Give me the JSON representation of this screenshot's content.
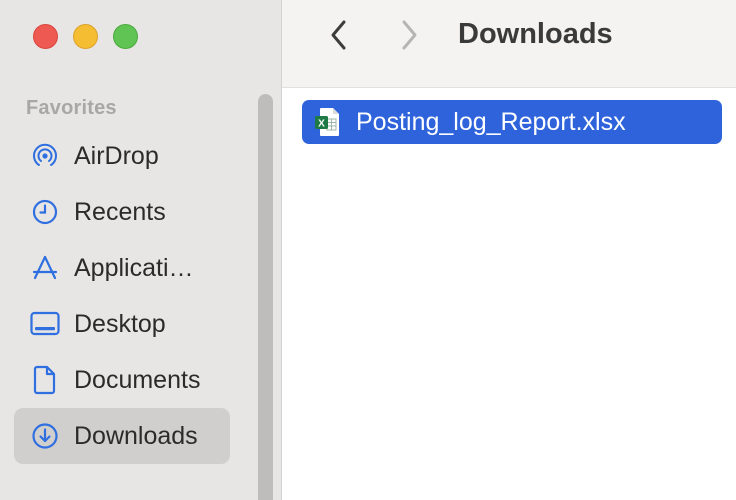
{
  "window": {
    "title": "Downloads"
  },
  "toolbar": {
    "back_icon": "chevron-left-icon",
    "forward_icon": "chevron-right-icon",
    "title": "Downloads"
  },
  "sidebar": {
    "section_title": "Favorites",
    "items": [
      {
        "label": "AirDrop",
        "icon": "airdrop-icon",
        "selected": false
      },
      {
        "label": "Recents",
        "icon": "clock-icon",
        "selected": false
      },
      {
        "label": "Applicati…",
        "icon": "applications-icon",
        "selected": false
      },
      {
        "label": "Desktop",
        "icon": "desktop-icon",
        "selected": false
      },
      {
        "label": "Documents",
        "icon": "document-icon",
        "selected": false
      },
      {
        "label": "Downloads",
        "icon": "download-icon",
        "selected": true
      }
    ]
  },
  "files": [
    {
      "name": "Posting_log_Report.xlsx",
      "icon": "excel-file-icon",
      "selected": true
    }
  ],
  "colors": {
    "accent": "#2e63db",
    "sidebar_icon": "#2f6fe0",
    "sidebar_bg": "#e8e6e5"
  }
}
